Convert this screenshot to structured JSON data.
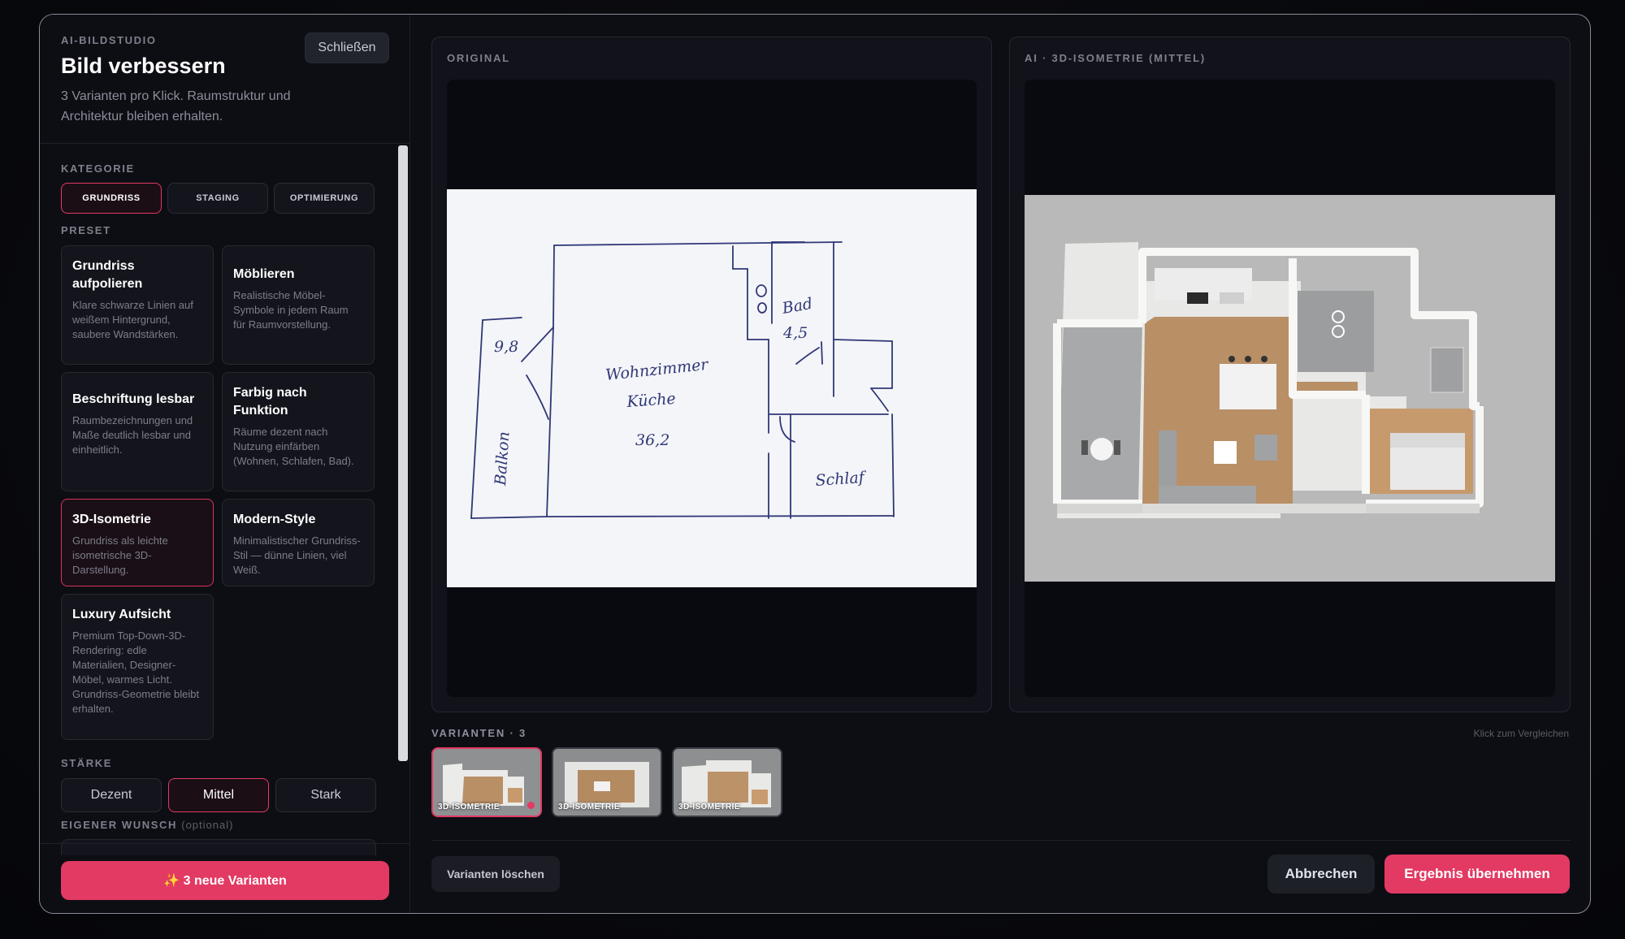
{
  "header": {
    "eyebrow": "AI-BILDSTUDIO",
    "title": "Bild verbessern",
    "subtitle": "3 Varianten pro Klick. Raumstruktur und Architektur bleiben erhalten.",
    "close_label": "Schließen"
  },
  "category": {
    "label": "KATEGORIE",
    "options": [
      "GRUNDRISS",
      "STAGING",
      "OPTIMIERUNG"
    ],
    "selected": "GRUNDRISS"
  },
  "preset": {
    "label": "PRESET",
    "items": [
      {
        "title": "Grundriss aufpolieren",
        "desc": "Klare schwarze Linien auf weißem Hintergrund, saubere Wandstärken."
      },
      {
        "title": "Möblieren",
        "desc": "Realistische Möbel-Symbole in jedem Raum für Raumvorstellung."
      },
      {
        "title": "Beschriftung lesbar",
        "desc": "Raumbezeichnungen und Maße deutlich lesbar und einheitlich."
      },
      {
        "title": "Farbig nach Funktion",
        "desc": "Räume dezent nach Nutzung einfärben (Wohnen, Schlafen, Bad)."
      },
      {
        "title": "3D-Isometrie",
        "desc": "Grundriss als leichte isometrische 3D-Darstellung."
      },
      {
        "title": "Modern-Style",
        "desc": "Minimalistischer Grundriss-Stil — dünne Linien, viel Weiß."
      },
      {
        "title": "Luxury Aufsicht",
        "desc": "Premium Top-Down-3D-Rendering: edle Materialien, Designer-Möbel, warmes Licht. Grundriss-Geometrie bleibt erhalten."
      }
    ],
    "selected": "3D-Isometrie"
  },
  "strength": {
    "label": "STÄRKE",
    "options": [
      "Dezent",
      "Mittel",
      "Stark"
    ],
    "selected": "Mittel"
  },
  "wish": {
    "label": "EIGENER WUNSCH",
    "optional": "(optional)"
  },
  "generate_label": "✨ 3 neue Varianten",
  "original": {
    "label": "ORIGINAL",
    "sketch_labels": {
      "room1": "Wohnzimmer",
      "room1b": "Küche",
      "room1_area": "36,2",
      "bad": "Bad",
      "bad_area": "4,5",
      "small": "9,8",
      "balkon": "Balkon",
      "schlaf": "Schlaf"
    }
  },
  "result": {
    "label": "AI · 3D-ISOMETRIE (MITTEL)"
  },
  "variants": {
    "label": "VARIANTEN · 3",
    "hint": "Klick zum Vergleichen",
    "items": [
      {
        "label": "3D-ISOMETRIE",
        "selected": true
      },
      {
        "label": "3D-ISOMETRIE",
        "selected": false
      },
      {
        "label": "3D-ISOMETRIE",
        "selected": false
      }
    ]
  },
  "footer": {
    "delete_label": "Varianten löschen",
    "cancel_label": "Abbrechen",
    "apply_label": "Ergebnis übernehmen"
  },
  "colors": {
    "accent": "#e23a63",
    "background": "#0d0e14",
    "panel": "#11121a"
  }
}
